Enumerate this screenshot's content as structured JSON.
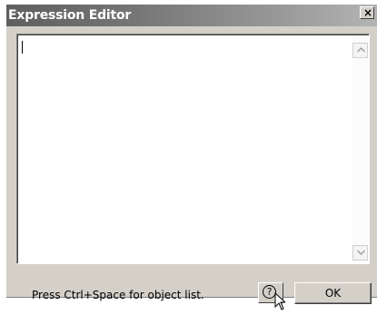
{
  "window": {
    "title": "Expression Editor",
    "close_symbol": "×"
  },
  "editor": {
    "value": ""
  },
  "footer": {
    "hint": "Press Ctrl+Space for object list.",
    "help_symbol": "?",
    "ok_label": "OK"
  },
  "icons": {
    "close": "close-icon",
    "scroll_up": "chevron-up-icon",
    "scroll_down": "chevron-down-icon",
    "help": "help-icon",
    "pointer": "mouse-pointer-icon"
  }
}
